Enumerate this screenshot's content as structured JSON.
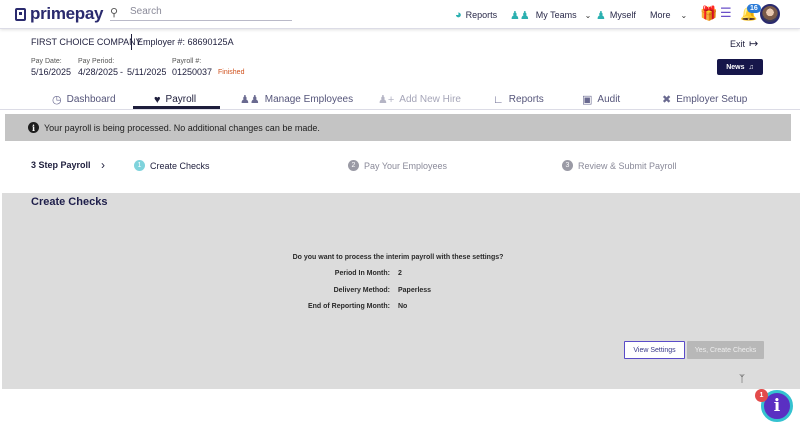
{
  "app": {
    "logo_text": "primepay"
  },
  "search": {
    "placeholder": "Search",
    "value": ""
  },
  "topnav": {
    "reports": "Reports",
    "my_teams": "My Teams",
    "myself": "Myself",
    "more": "More",
    "notification_count": "16"
  },
  "company": {
    "name": "FIRST CHOICE COMPANY",
    "employer": "Employer #: 68690125A",
    "exit": "Exit"
  },
  "payroll_info": {
    "pay_date_label": "Pay Date:",
    "pay_date": "5/16/2025",
    "pay_period_label": "Pay Period:",
    "pay_period_start": "4/28/2025",
    "pay_period_sep": "-",
    "pay_period_end": "5/11/2025",
    "payroll_num_label": "Payroll #:",
    "payroll_num": "01250037",
    "status": "Finished",
    "news": "News"
  },
  "tabs": [
    {
      "label": "Dashboard",
      "icon": "dashboard-icon"
    },
    {
      "label": "Payroll",
      "icon": "payroll-bag-icon"
    },
    {
      "label": "Manage Employees",
      "icon": "people-icon"
    },
    {
      "label": "Add New Hire",
      "icon": "add-person-icon"
    },
    {
      "label": "Reports",
      "icon": "chart-icon"
    },
    {
      "label": "Audit",
      "icon": "briefcase-icon"
    },
    {
      "label": "Employer Setup",
      "icon": "tools-icon"
    }
  ],
  "alert": {
    "text": "Your payroll is being processed. No additional changes can be made."
  },
  "steps": {
    "title": "3 Step Payroll",
    "items": [
      {
        "num": "1",
        "label": "Create Checks"
      },
      {
        "num": "2",
        "label": "Pay Your Employees"
      },
      {
        "num": "3",
        "label": "Review & Submit Payroll"
      }
    ]
  },
  "create_checks": {
    "title": "Create Checks",
    "question": "Do you want to process the interim payroll with these settings?",
    "settings": [
      {
        "label": "Period In Month:",
        "value": "2"
      },
      {
        "label": "Delivery Method:",
        "value": "Paperless"
      },
      {
        "label": "End of Reporting Month:",
        "value": "No"
      }
    ],
    "view_settings": "View Settings",
    "create_button": "Yes, Create Checks"
  },
  "help": {
    "badge": "1",
    "label": "i"
  },
  "colors": {
    "brand": "#2a2a6e",
    "accent_teal": "#2bb0b0",
    "status_orange": "#d0521e",
    "help_purple": "#5a2fc2"
  }
}
